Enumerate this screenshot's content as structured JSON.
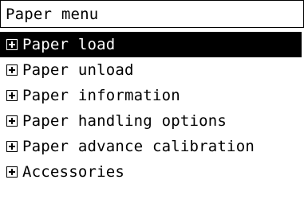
{
  "window": {
    "title": "Paper menu"
  },
  "menu": {
    "items": [
      {
        "label": "Paper load",
        "icon": "expand-plus-icon",
        "selected": true
      },
      {
        "label": "Paper unload",
        "icon": "expand-plus-icon",
        "selected": false
      },
      {
        "label": "Paper information",
        "icon": "expand-plus-icon",
        "selected": false
      },
      {
        "label": "Paper handling options",
        "icon": "expand-plus-icon",
        "selected": false
      },
      {
        "label": "Paper advance calibration",
        "icon": "expand-plus-icon",
        "selected": false
      },
      {
        "label": "Accessories",
        "icon": "expand-plus-icon",
        "selected": false
      }
    ]
  },
  "colors": {
    "background": "#ffffff",
    "text": "#000000",
    "selection_background": "#000000",
    "selection_text": "#ffffff"
  }
}
